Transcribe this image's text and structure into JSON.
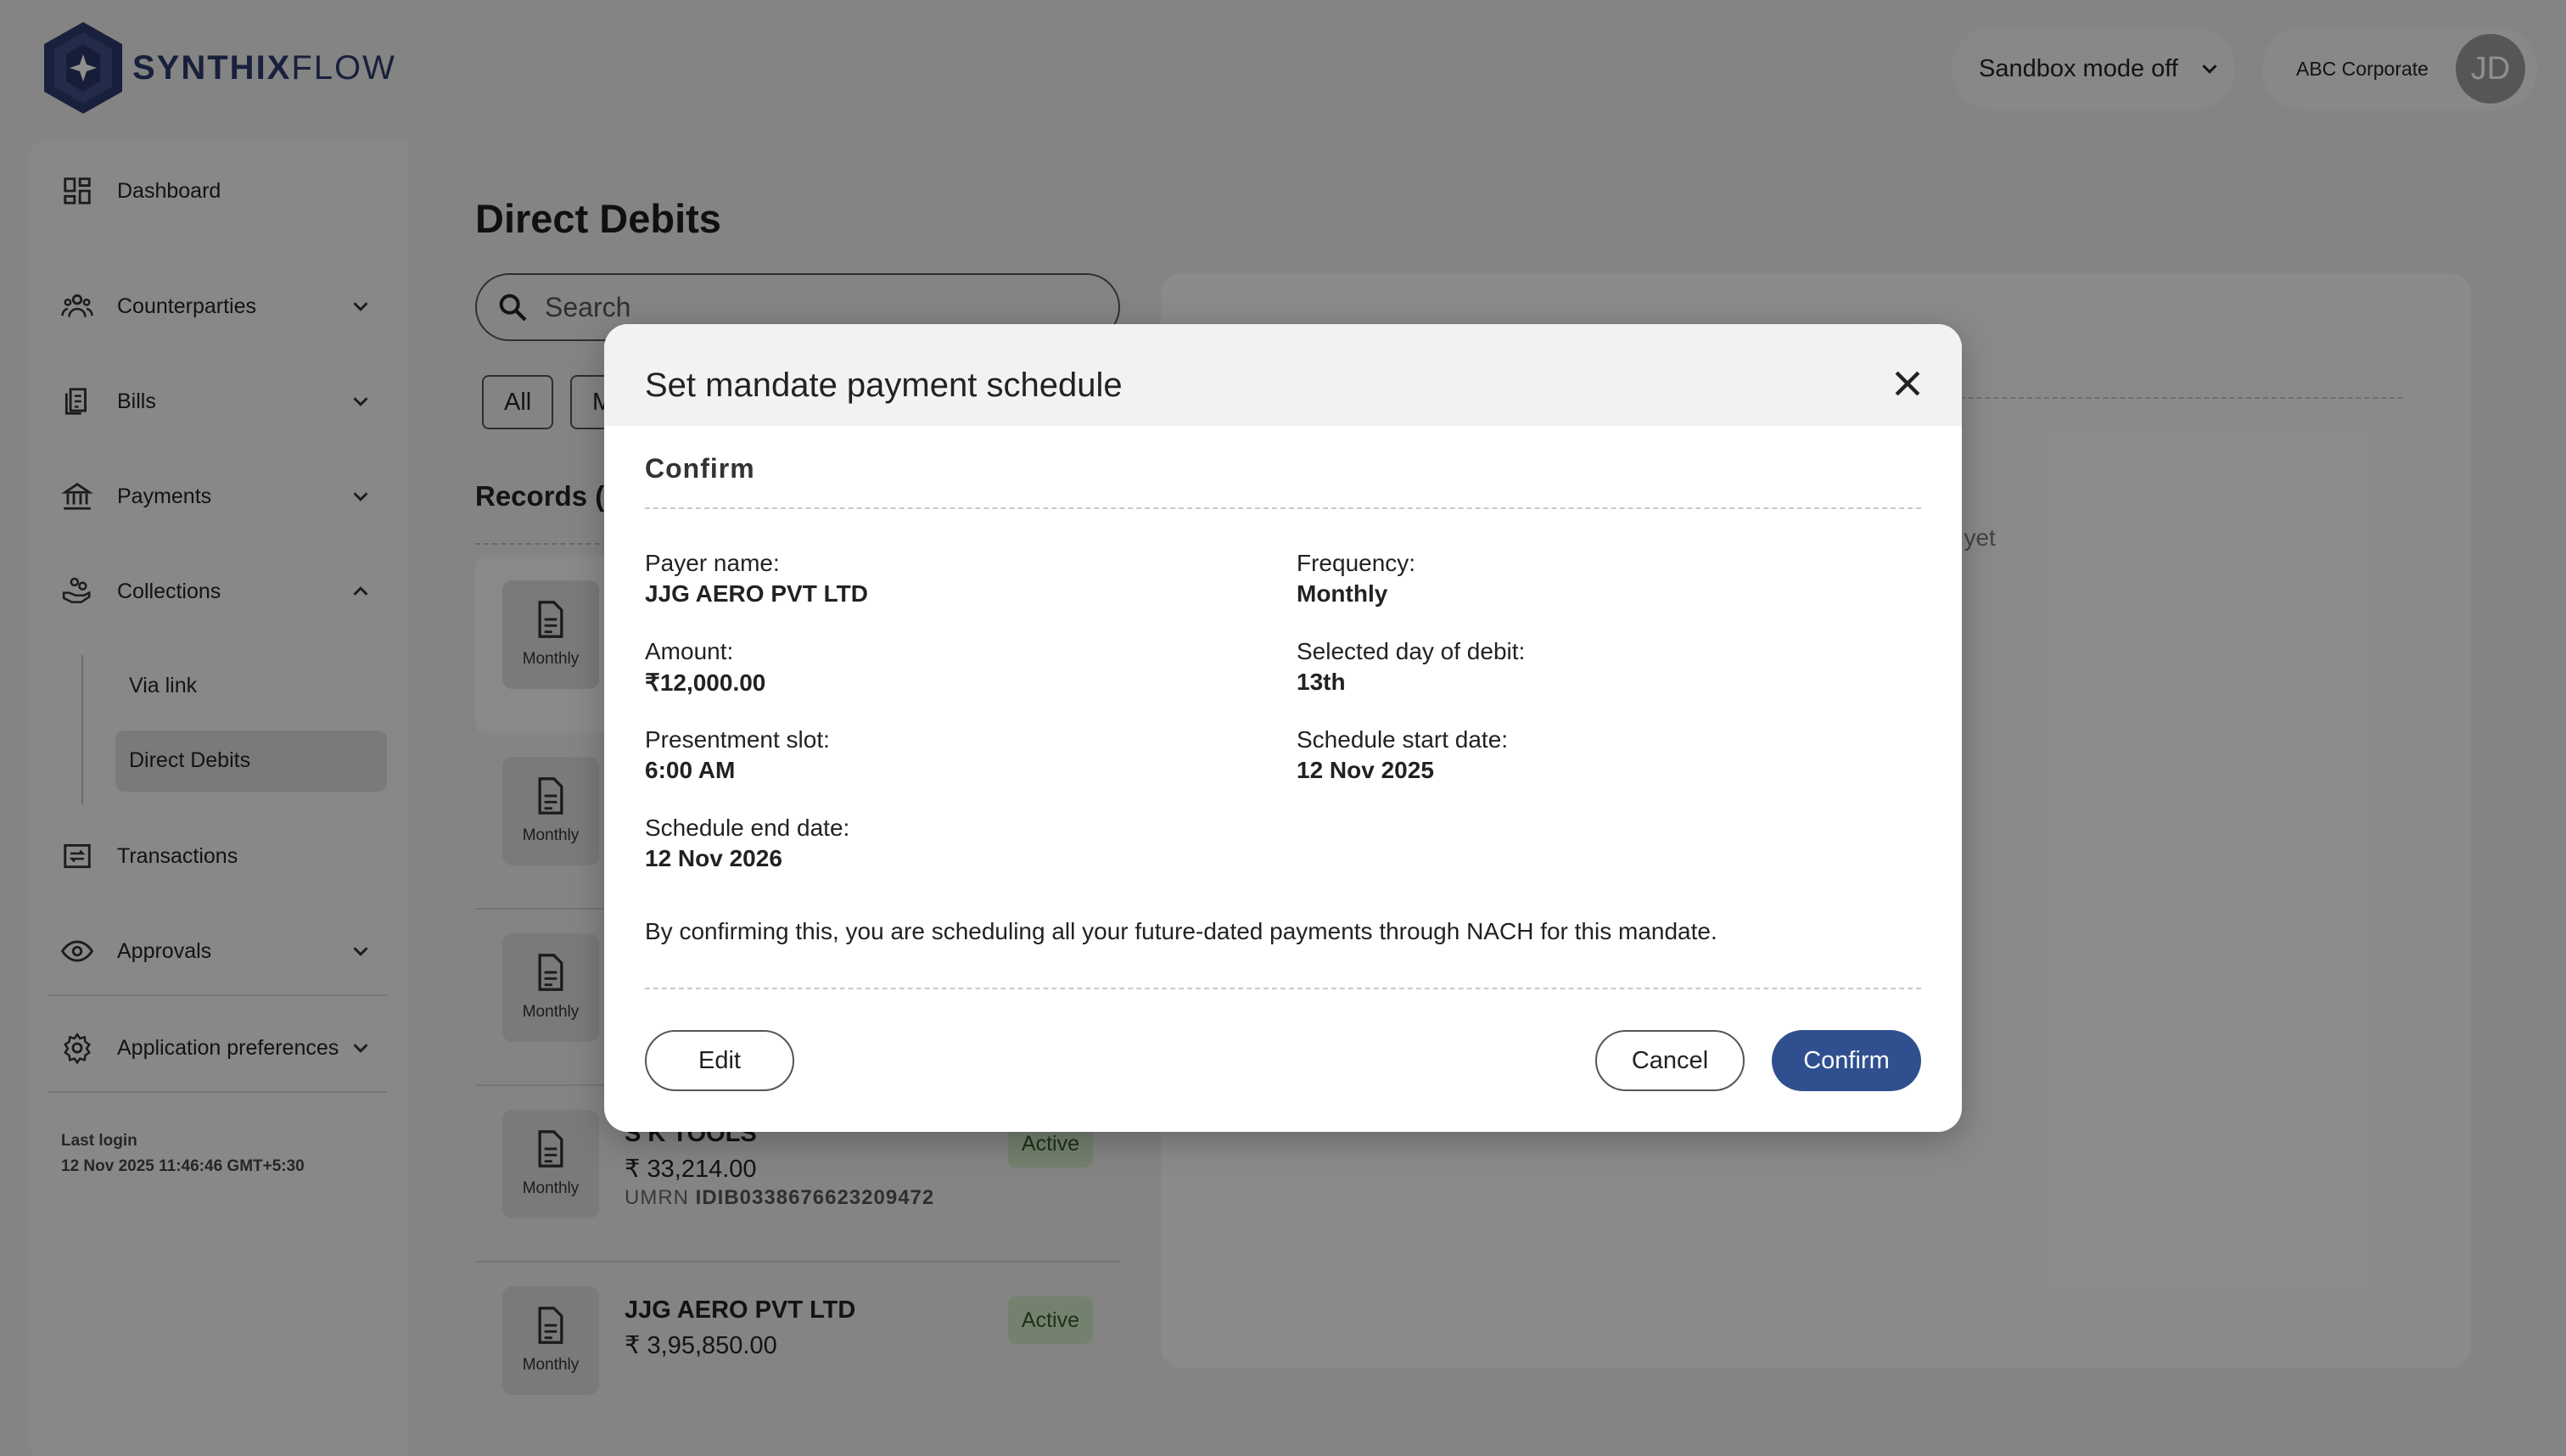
{
  "header": {
    "brand_part1": "SYNTHIX",
    "brand_part2": "FLOW",
    "sandbox_label": "Sandbox mode off",
    "account_name": "ABC Corporate",
    "avatar_initials": "JD"
  },
  "sidebar": {
    "items": [
      {
        "label": "Dashboard",
        "icon": "dashboard-icon"
      },
      {
        "label": "Counterparties",
        "icon": "people-icon"
      },
      {
        "label": "Bills",
        "icon": "bills-icon"
      },
      {
        "label": "Payments",
        "icon": "bank-icon"
      },
      {
        "label": "Collections",
        "icon": "collections-icon"
      },
      {
        "label": "Transactions",
        "icon": "transactions-icon"
      },
      {
        "label": "Approvals",
        "icon": "eye-icon"
      },
      {
        "label": "Application preferences",
        "icon": "gear-icon"
      }
    ],
    "collections_sub": [
      "Via link",
      "Direct Debits"
    ],
    "last_login_label": "Last login",
    "last_login_value": "12 Nov 2025 11:46:46 GMT+5:30"
  },
  "main": {
    "title": "Direct Debits",
    "search_placeholder": "Search",
    "filter_chips": [
      "All",
      "M"
    ],
    "records_heading": "Records (",
    "right_panel_text": "t up yet",
    "records": [
      {
        "frequency": "Monthly"
      },
      {
        "frequency": "Monthly"
      },
      {
        "frequency": "Monthly"
      },
      {
        "frequency": "Monthly",
        "name": "S K TOOLS",
        "amount": "₹ 33,214.00",
        "umrn_label": "UMRN",
        "umrn": "IDIB0338676623209472",
        "status": "Active"
      },
      {
        "frequency": "Monthly",
        "name": "JJG AERO PVT LTD",
        "amount": "₹ 3,95,850.00",
        "status": "Active"
      }
    ]
  },
  "modal": {
    "title": "Set mandate payment schedule",
    "step": "Confirm",
    "fields": {
      "payer_name_label": "Payer name:",
      "payer_name": "JJG AERO PVT LTD",
      "frequency_label": "Frequency:",
      "frequency": "Monthly",
      "amount_label": "Amount:",
      "amount": "₹12,000.00",
      "day_label": "Selected day of debit:",
      "day": "13th",
      "slot_label": "Presentment slot:",
      "slot": "6:00 AM",
      "start_label": "Schedule start date:",
      "start": "12 Nov 2025",
      "end_label": "Schedule end date:",
      "end": "12 Nov 2026"
    },
    "disclaimer": "By confirming this, you are scheduling all your future-dated payments through NACH for this mandate.",
    "edit_label": "Edit",
    "cancel_label": "Cancel",
    "confirm_label": "Confirm",
    "confirm_color": "#2f4f8f"
  }
}
